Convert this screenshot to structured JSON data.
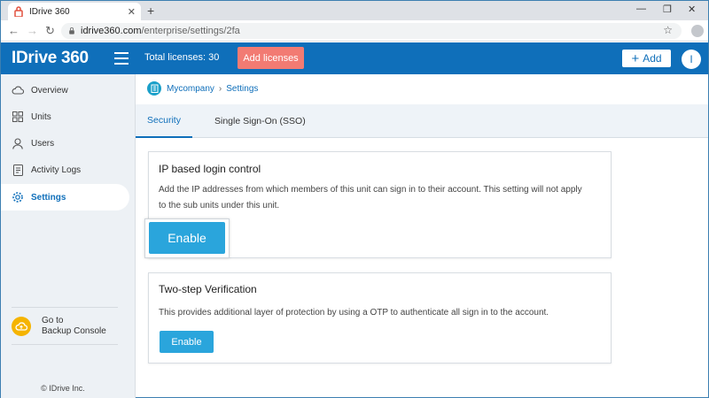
{
  "browser": {
    "tab_title": "IDrive 360",
    "url_host": "idrive360.com",
    "url_path": "/enterprise/settings/2fa"
  },
  "header": {
    "logo": "IDrive 360",
    "total_licenses": "Total licenses: 30",
    "add_licenses": "Add licenses",
    "add_button": "Add",
    "avatar_initial": "I"
  },
  "sidebar": {
    "items": [
      {
        "label": "Overview",
        "icon": "cloud-icon"
      },
      {
        "label": "Units",
        "icon": "grid-icon"
      },
      {
        "label": "Users",
        "icon": "user-icon"
      },
      {
        "label": "Activity Logs",
        "icon": "document-icon"
      },
      {
        "label": "Settings",
        "icon": "gear-icon",
        "active": true
      }
    ],
    "goto_line1": "Go to",
    "goto_line2": "Backup Console",
    "copyright": "© IDrive Inc."
  },
  "breadcrumb": {
    "root": "Mycompany",
    "current": "Settings"
  },
  "tabs": [
    {
      "label": "Security",
      "active": true
    },
    {
      "label": "Single Sign-On (SSO)",
      "active": false
    }
  ],
  "cards": {
    "ip": {
      "title": "IP based login control",
      "desc_line1": "Add the IP addresses from which members of this unit can sign in to their account. This setting will not apply",
      "desc_line2": "to the sub units under this unit.",
      "button": "Enable"
    },
    "twostep": {
      "title": "Two-step Verification",
      "desc": "This provides additional layer of protection by using a OTP to authenticate all sign in to the account.",
      "button": "Enable"
    }
  },
  "colors": {
    "brand_blue": "#0f6fba",
    "add_licenses_bg": "#f27b73",
    "enable_button": "#2aa5dc"
  }
}
